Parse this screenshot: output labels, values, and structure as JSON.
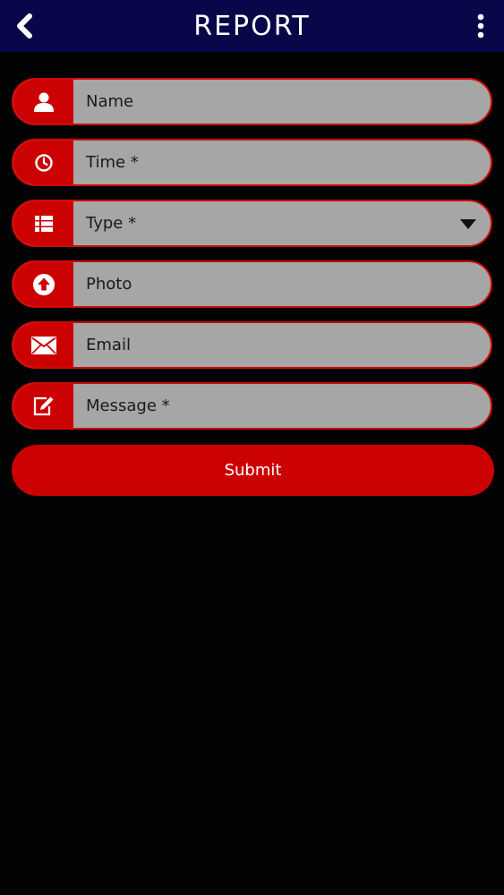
{
  "header": {
    "title": "REPORT",
    "back_icon": "chevron-left-icon",
    "menu_icon": "more-vertical-icon"
  },
  "form": {
    "fields": [
      {
        "icon": "user-icon",
        "label": "Name"
      },
      {
        "icon": "clock-icon",
        "label": "Time *"
      },
      {
        "icon": "list-icon",
        "label": "Type *",
        "dropdown": true
      },
      {
        "icon": "upload-icon",
        "label": "Photo"
      },
      {
        "icon": "envelope-icon",
        "label": "Email"
      },
      {
        "icon": "edit-icon",
        "label": "Message *"
      }
    ],
    "submit_label": "Submit"
  },
  "colors": {
    "header_bg": "#08074a",
    "accent_red": "#cc0202",
    "field_bg": "#a6a6a6",
    "page_bg": "#030303"
  }
}
